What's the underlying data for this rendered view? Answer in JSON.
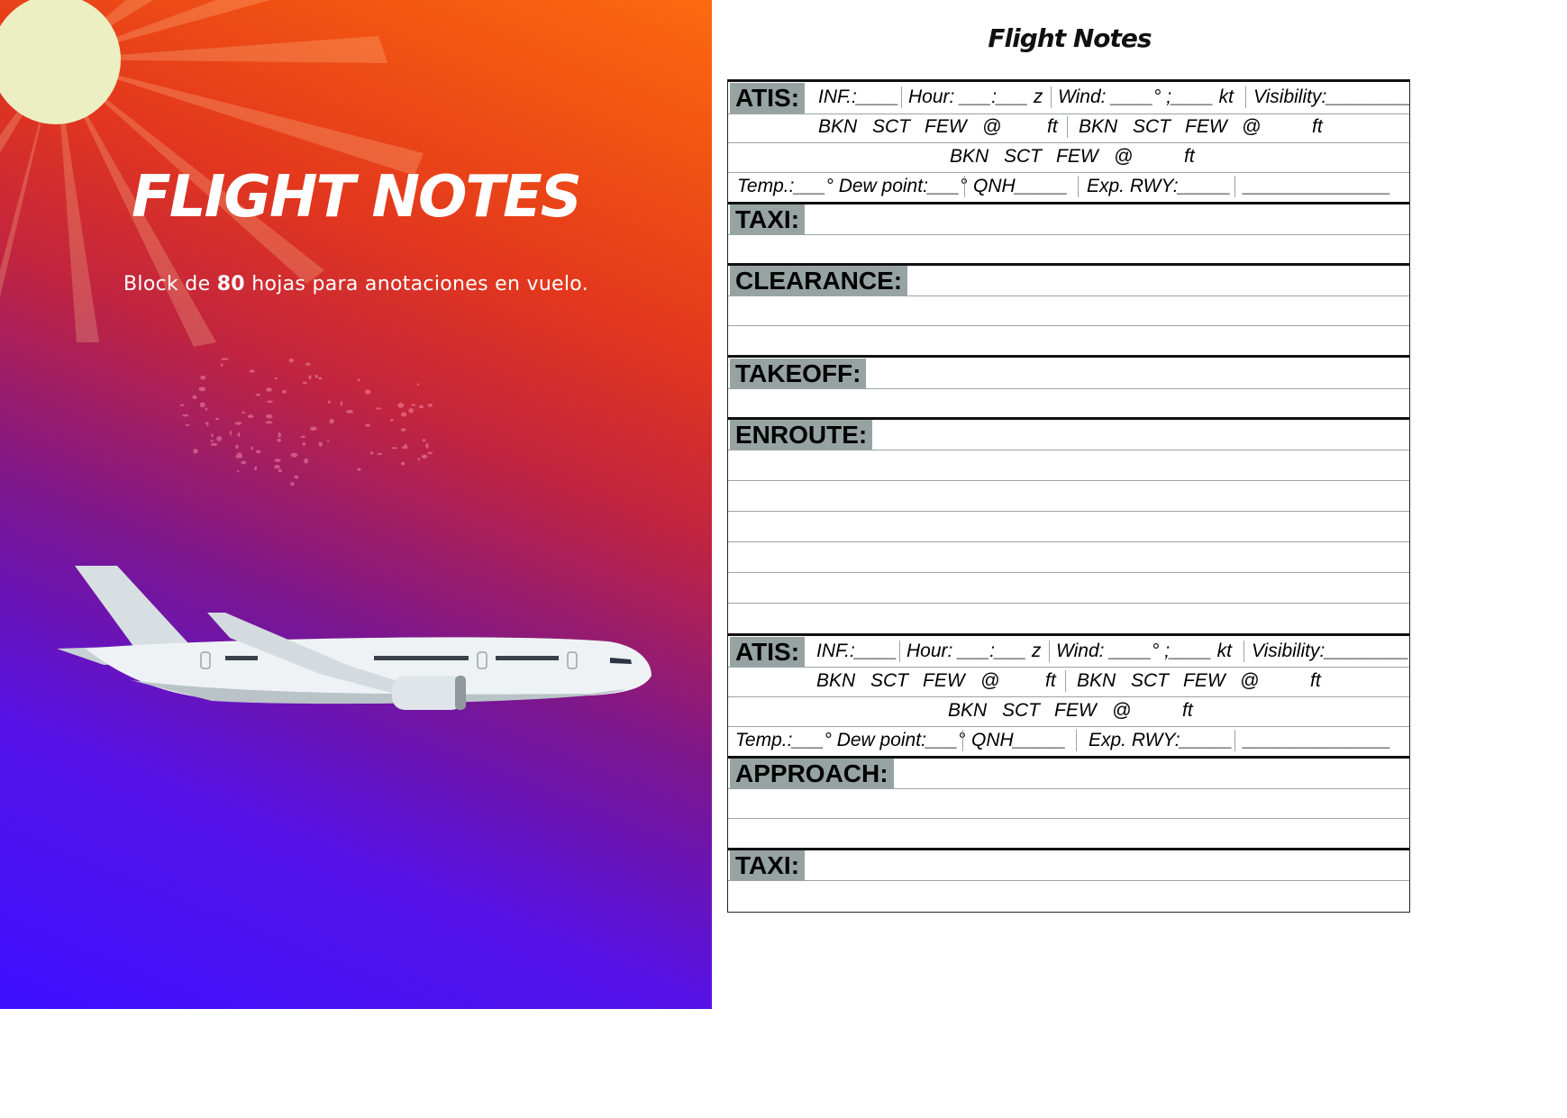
{
  "cover": {
    "title": "FLIGHT NOTES",
    "subtitle_pre": "Block de ",
    "subtitle_bold": "80",
    "subtitle_post": " hojas para anotaciones en vuelo.",
    "colors": {
      "top": "#fb6a10",
      "middle": "#c02440",
      "bottom": "#3d10ff",
      "sun": "#ecefc2"
    }
  },
  "form": {
    "title": "Flight Notes",
    "atis": {
      "label": "ATIS:",
      "inf": "INF.:____",
      "hour": "Hour: ___:___ z",
      "wind": "Wind: ____° ;____ kt",
      "visibility": "Visibility:________",
      "cloud_word_bkn": "BKN",
      "cloud_word_sct": "SCT",
      "cloud_word_few": "FEW",
      "cloud_at": "@",
      "cloud_unit": "ft",
      "temp": "Temp.:___° Dew point:___°",
      "qnh": "QNH_____",
      "exp_rwy": "Exp. RWY:_____",
      "blank": "______________"
    },
    "sections": {
      "taxi": "TAXI:",
      "clearance": "CLEARANCE:",
      "takeoff": "TAKEOFF:",
      "enroute": "ENROUTE:",
      "approach": "APPROACH:"
    }
  }
}
